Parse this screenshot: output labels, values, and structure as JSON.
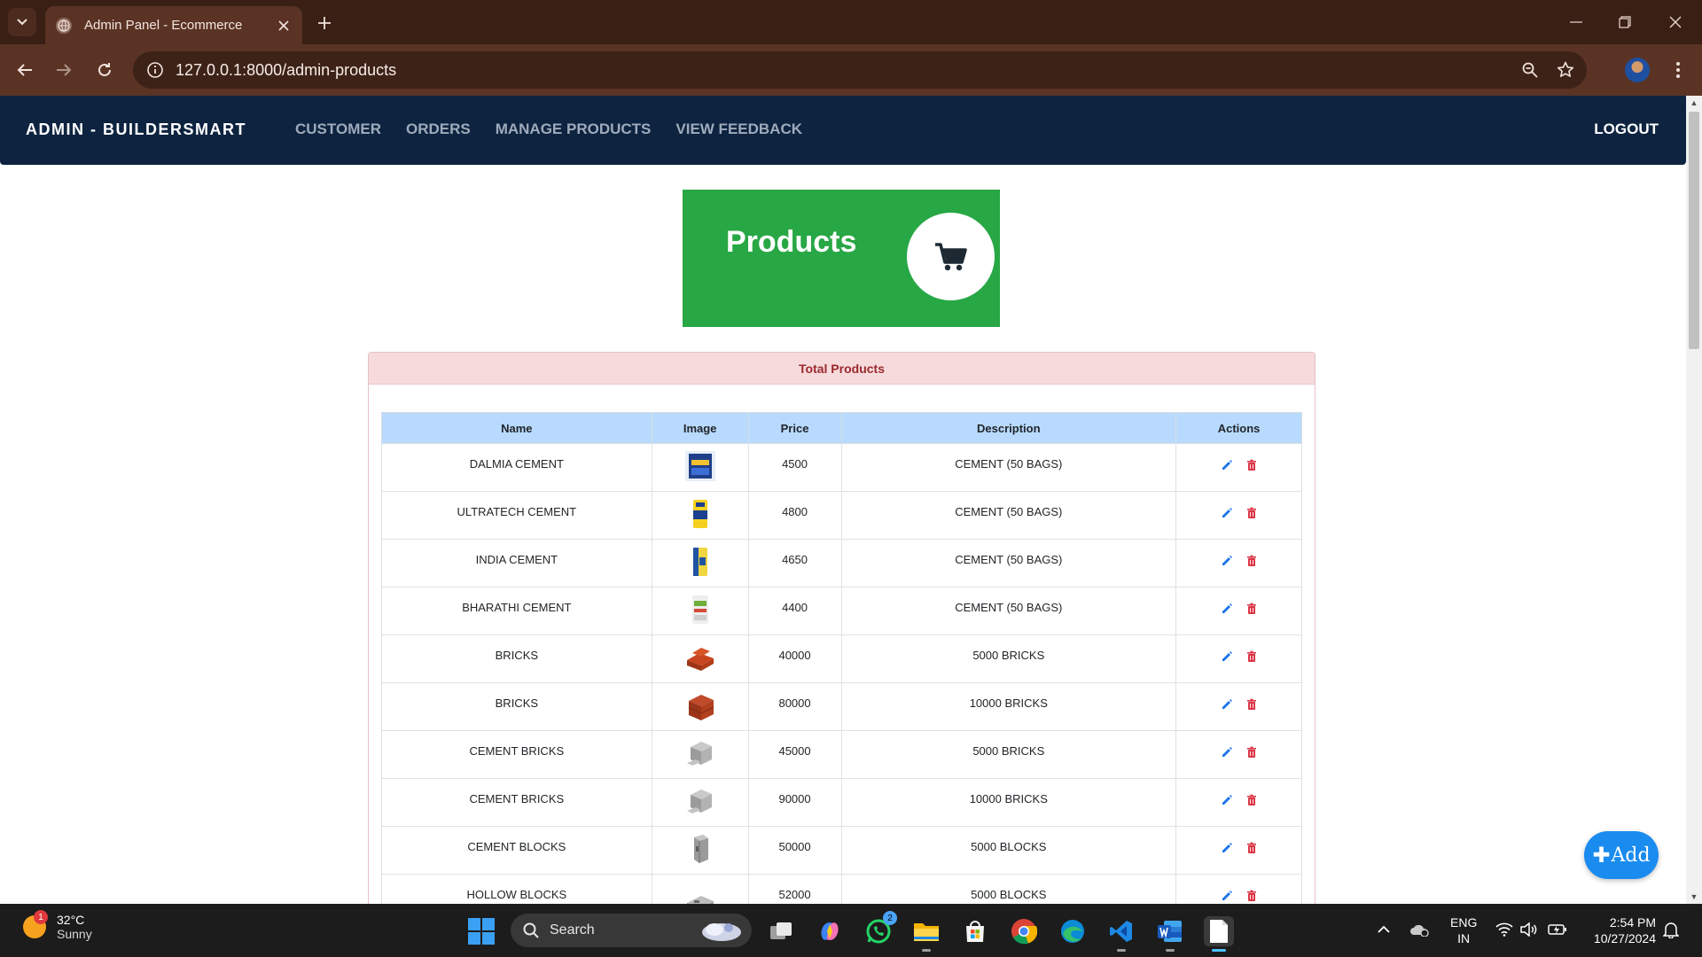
{
  "browser": {
    "tab_title": "Admin Panel - Ecommerce",
    "url": "127.0.0.1:8000/admin-products"
  },
  "nav": {
    "brand": "ADMIN - BUILDERSMART",
    "links": [
      "CUSTOMER",
      "ORDERS",
      "MANAGE PRODUCTS",
      "VIEW FEEDBACK"
    ],
    "logout": "LOGOUT"
  },
  "hero": {
    "title": "Products",
    "icon": "cart-icon",
    "color": "#28a745"
  },
  "card": {
    "header": "Total Products"
  },
  "table": {
    "columns": [
      "Name",
      "Image",
      "Price",
      "Description",
      "Actions"
    ],
    "rows": [
      {
        "name": "DALMIA CEMENT",
        "image": "cement-bag-blue",
        "price": "4500",
        "description": "CEMENT (50 BAGS)"
      },
      {
        "name": "ULTRATECH CEMENT",
        "image": "cement-bag-yellow",
        "price": "4800",
        "description": "CEMENT (50 BAGS)"
      },
      {
        "name": "INDIA CEMENT",
        "image": "cement-bag-yellow-blue",
        "price": "4650",
        "description": "CEMENT (50 BAGS)"
      },
      {
        "name": "BHARATHI CEMENT",
        "image": "cement-bag-white",
        "price": "4400",
        "description": "CEMENT (50 BAGS)"
      },
      {
        "name": "BRICKS",
        "image": "bricks-red",
        "price": "40000",
        "description": "5000 BRICKS"
      },
      {
        "name": "BRICKS",
        "image": "bricks-red-stack",
        "price": "80000",
        "description": "10000 BRICKS"
      },
      {
        "name": "CEMENT BRICKS",
        "image": "cement-bricks-grey",
        "price": "45000",
        "description": "5000 BRICKS"
      },
      {
        "name": "CEMENT BRICKS",
        "image": "cement-bricks-grey",
        "price": "90000",
        "description": "10000 BRICKS"
      },
      {
        "name": "CEMENT BLOCKS",
        "image": "cement-block-grey",
        "price": "50000",
        "description": "5000 BLOCKS"
      },
      {
        "name": "HOLLOW BLOCKS",
        "image": "hollow-block-grey",
        "price": "52000",
        "description": "5000 BLOCKS"
      }
    ],
    "edit_icon": "pencil-icon",
    "delete_icon": "trash-icon",
    "edit_color": "#1a73e8",
    "delete_color": "#dc3545"
  },
  "add_button": "Add",
  "taskbar": {
    "weather_temp": "32°C",
    "weather_desc": "Sunny",
    "weather_badge": "1",
    "search_label": "Search",
    "whatsapp_badge": "2",
    "lang_top": "ENG",
    "lang_bottom": "IN",
    "time": "2:54 PM",
    "date": "10/27/2024"
  }
}
